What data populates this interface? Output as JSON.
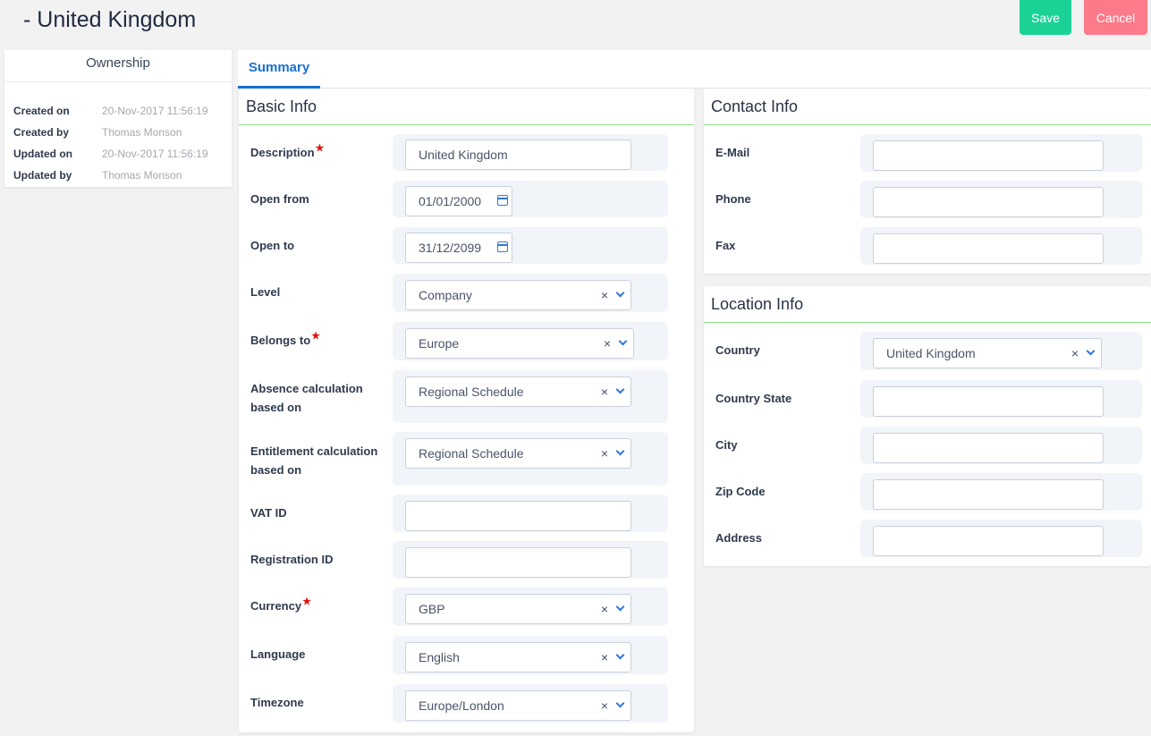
{
  "header": {
    "title": "- United Kingdom",
    "save_label": "Save",
    "cancel_label": "Cancel"
  },
  "ownership": {
    "title": "Ownership",
    "rows": [
      {
        "label": "Created on",
        "value": "20-Nov-2017 11:56:19"
      },
      {
        "label": "Created by",
        "value": "Thomas Monson"
      },
      {
        "label": "Updated on",
        "value": "20-Nov-2017 11:56:19"
      },
      {
        "label": "Updated by",
        "value": "Thomas Monson"
      }
    ]
  },
  "tabs": [
    {
      "label": "Summary",
      "active": true
    }
  ],
  "basic_info": {
    "title": "Basic Info",
    "fields": {
      "description": {
        "label": "Description",
        "value": "United Kingdom",
        "required": "★"
      },
      "open_from": {
        "label": "Open from",
        "value": "01/01/2000"
      },
      "open_to": {
        "label": "Open to",
        "value": "31/12/2099"
      },
      "level": {
        "label": "Level",
        "value": "Company"
      },
      "belongs_to": {
        "label": "Belongs to",
        "value": "Europe",
        "required": "★"
      },
      "absence_calc": {
        "label_line1": "Absence calculation",
        "label_line2": "based on",
        "value": "Regional Schedule"
      },
      "entitlement_calc": {
        "label_line1": "Entitlement calculation",
        "label_line2": "based on",
        "value": "Regional Schedule"
      },
      "vat_id": {
        "label": "VAT ID",
        "value": ""
      },
      "registration_id": {
        "label": "Registration ID",
        "value": ""
      },
      "currency": {
        "label": "Currency",
        "value": "GBP",
        "required": "★"
      },
      "language": {
        "label": "Language",
        "value": "English"
      },
      "timezone": {
        "label": "Timezone",
        "value": "Europe/London"
      }
    }
  },
  "contact_info": {
    "title": "Contact Info",
    "fields": {
      "email": {
        "label": "E-Mail",
        "value": ""
      },
      "phone": {
        "label": "Phone",
        "value": ""
      },
      "fax": {
        "label": "Fax",
        "value": ""
      }
    }
  },
  "location_info": {
    "title": "Location Info",
    "fields": {
      "country": {
        "label": "Country",
        "value": "United Kingdom"
      },
      "country_state": {
        "label": "Country State",
        "value": ""
      },
      "city": {
        "label": "City",
        "value": ""
      },
      "zip_code": {
        "label": "Zip Code",
        "value": ""
      },
      "address": {
        "label": "Address",
        "value": ""
      }
    }
  },
  "icons": {
    "clear": "×"
  },
  "colors": {
    "accent": "#1a6fd6",
    "save": "#1bd296",
    "cancel": "#fc7b8b",
    "required": "#e51212",
    "section_rule": "#8fe08a"
  }
}
